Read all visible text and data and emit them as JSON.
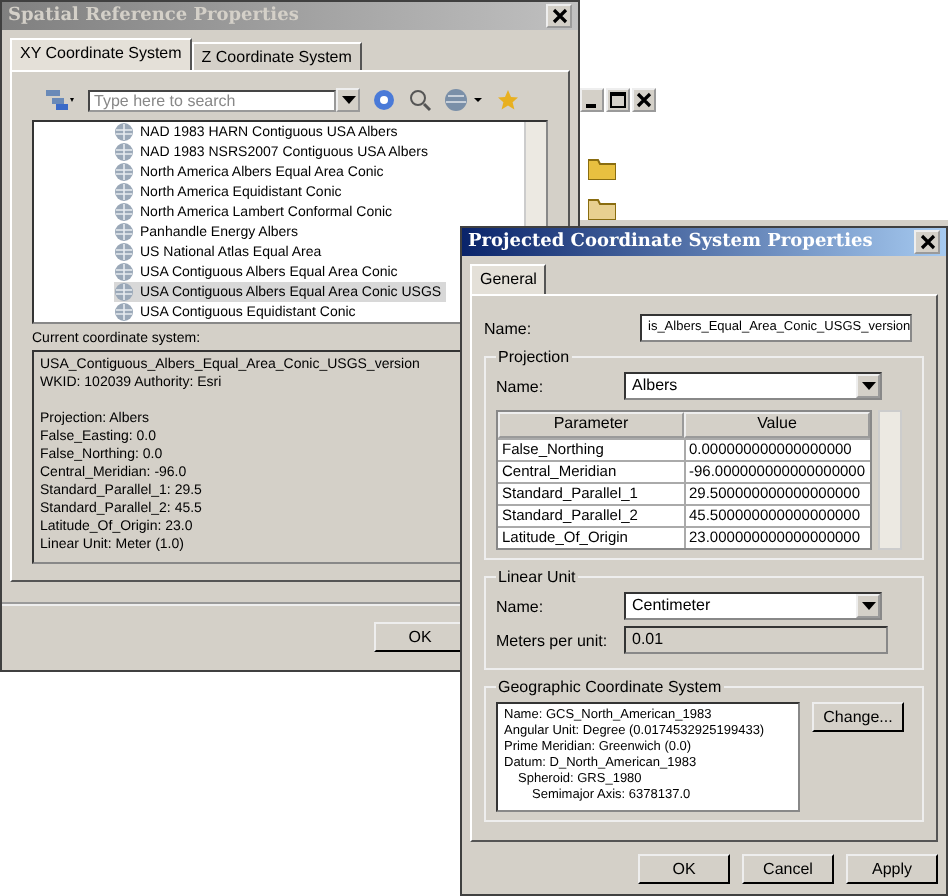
{
  "back_window": {
    "title": "Spatial Reference Properties",
    "tabs": [
      {
        "label": "XY Coordinate System",
        "selected": true
      },
      {
        "label": "Z Coordinate System",
        "selected": false
      }
    ],
    "search": {
      "placeholder": "Type here to search"
    },
    "list": [
      {
        "label": "NAD 1983 HARN Contiguous USA Albers",
        "selected": false
      },
      {
        "label": "NAD 1983 NSRS2007 Contiguous USA Albers",
        "selected": false
      },
      {
        "label": "North America Albers Equal Area Conic",
        "selected": false
      },
      {
        "label": "North America Equidistant Conic",
        "selected": false
      },
      {
        "label": "North America Lambert Conformal Conic",
        "selected": false
      },
      {
        "label": "Panhandle Energy Albers",
        "selected": false
      },
      {
        "label": "US National Atlas Equal Area",
        "selected": false
      },
      {
        "label": "USA Contiguous Albers Equal Area Conic",
        "selected": false
      },
      {
        "label": "USA Contiguous Albers Equal Area Conic USGS",
        "selected": true
      },
      {
        "label": "USA Contiguous Equidistant Conic",
        "selected": false
      }
    ],
    "current_label": "Current coordinate system:",
    "current_text": [
      [
        "USA_Contiguous_Albers_Equal_Area_Conic_USGS_version",
        "WKID: 102039 Authority: Esri"
      ],
      [
        "Projection: Albers",
        "False_Easting: 0.0",
        "False_Northing: 0.0",
        "Central_Meridian: -96.0",
        "Standard_Parallel_1: 29.5",
        "Standard_Parallel_2: 45.5",
        "Latitude_Of_Origin: 23.0",
        "Linear Unit: Meter (1.0)"
      ]
    ],
    "ok": "OK"
  },
  "front_window": {
    "title": "Projected Coordinate System Properties",
    "tabs": [
      {
        "label": "General",
        "selected": true
      }
    ],
    "name_label": "Name:",
    "name_value": "is_Albers_Equal_Area_Conic_USGS_version",
    "projection": {
      "legend": "Projection",
      "name_label": "Name:",
      "name_value": "Albers",
      "columns": [
        "Parameter",
        "Value"
      ],
      "rows": [
        [
          "False_Northing",
          "0.000000000000000000"
        ],
        [
          "Central_Meridian",
          "-96.000000000000000000"
        ],
        [
          "Standard_Parallel_1",
          "29.500000000000000000"
        ],
        [
          "Standard_Parallel_2",
          "45.500000000000000000"
        ],
        [
          "Latitude_Of_Origin",
          "23.000000000000000000"
        ]
      ]
    },
    "linear_unit": {
      "legend": "Linear Unit",
      "name_label": "Name:",
      "name_value": "Centimeter",
      "meters_label": "Meters per unit:",
      "meters_value": "0.01"
    },
    "gcs": {
      "legend": "Geographic Coordinate System",
      "lines": [
        {
          "text": "Name: GCS_North_American_1983"
        },
        {
          "text": "Angular Unit: Degree (0.0174532925199433)"
        },
        {
          "text": "Prime Meridian: Greenwich (0.0)"
        },
        {
          "text": "Datum: D_North_American_1983",
          "children": [
            {
              "text": "Spheroid: GRS_1980",
              "children": [
                {
                  "text": "Semimajor Axis: 6378137.0"
                }
              ]
            }
          ]
        }
      ],
      "change": "Change..."
    },
    "buttons": [
      "OK",
      "Cancel",
      "Apply"
    ]
  }
}
